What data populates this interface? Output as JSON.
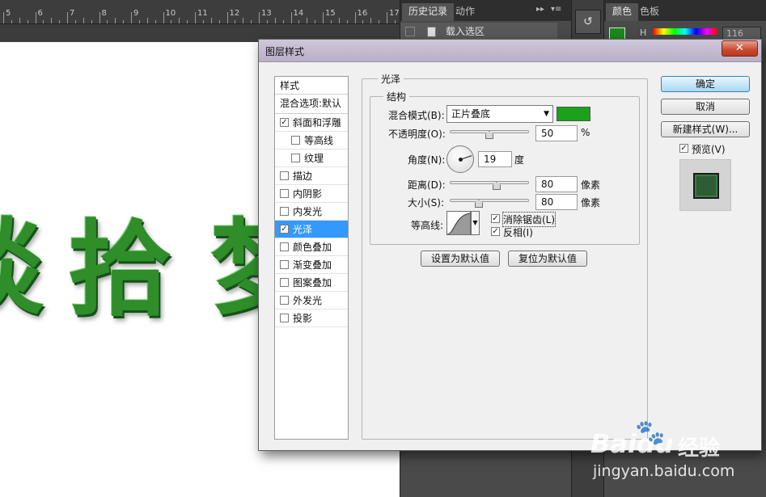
{
  "ruler": {
    "numbers": [
      "5",
      "6",
      "7",
      "8",
      "9",
      "10",
      "11",
      "12",
      "13",
      "14",
      "15",
      "16",
      "17"
    ]
  },
  "canvas": {
    "chars": [
      "谈",
      "拾",
      "梦"
    ]
  },
  "history_panel": {
    "tabs": [
      "历史记录",
      "动作"
    ],
    "menu_icons": [
      "double-chevron-right-icon",
      "panel-menu-icon"
    ],
    "row_label": "载入选区"
  },
  "color_panel": {
    "tabs": [
      "颜色",
      "色板"
    ],
    "h_label": "H",
    "h_value": "116",
    "foreground_color": "#1a8a1a"
  },
  "dialog": {
    "title": "图层样式",
    "close_label": "✕",
    "styles_header": "样式",
    "blend_options": "混合选项:默认",
    "style_items": [
      {
        "label": "斜面和浮雕",
        "checked": true,
        "sub": false,
        "selected": false
      },
      {
        "label": "等高线",
        "checked": false,
        "sub": true,
        "selected": false
      },
      {
        "label": "纹理",
        "checked": false,
        "sub": true,
        "selected": false
      },
      {
        "label": "描边",
        "checked": false,
        "sub": false,
        "selected": false
      },
      {
        "label": "内阴影",
        "checked": false,
        "sub": false,
        "selected": false
      },
      {
        "label": "内发光",
        "checked": false,
        "sub": false,
        "selected": false
      },
      {
        "label": "光泽",
        "checked": true,
        "sub": false,
        "selected": true
      },
      {
        "label": "颜色叠加",
        "checked": false,
        "sub": false,
        "selected": false
      },
      {
        "label": "渐变叠加",
        "checked": false,
        "sub": false,
        "selected": false
      },
      {
        "label": "图案叠加",
        "checked": false,
        "sub": false,
        "selected": false
      },
      {
        "label": "外发光",
        "checked": false,
        "sub": false,
        "selected": false
      },
      {
        "label": "投影",
        "checked": false,
        "sub": false,
        "selected": false
      }
    ],
    "gloss": {
      "section_title": "光泽",
      "structure_title": "结构",
      "blend_mode_label": "混合模式(B):",
      "blend_mode_value": "正片叠底",
      "blend_color": "#1aa31a",
      "opacity_label": "不透明度(O):",
      "opacity_value": "50",
      "opacity_unit": "%",
      "angle_label": "角度(N):",
      "angle_value": "19",
      "angle_unit": "度",
      "distance_label": "距离(D):",
      "distance_value": "80",
      "distance_unit": "像素",
      "size_label": "大小(S):",
      "size_value": "80",
      "size_unit": "像素",
      "contour_label": "等高线:",
      "antialias_label": "消除锯齿(L)",
      "antialias_checked": true,
      "invert_label": "反相(I)",
      "invert_checked": true,
      "set_default_label": "设置为默认值",
      "reset_default_label": "复位为默认值"
    },
    "ok_label": "确定",
    "cancel_label": "取消",
    "new_style_label": "新建样式(W)...",
    "preview_label": "预览(V)",
    "preview_checked": true
  },
  "watermark": {
    "logo": "Baidu",
    "jingyan": "经验",
    "url": "jingyan.baidu.com"
  }
}
